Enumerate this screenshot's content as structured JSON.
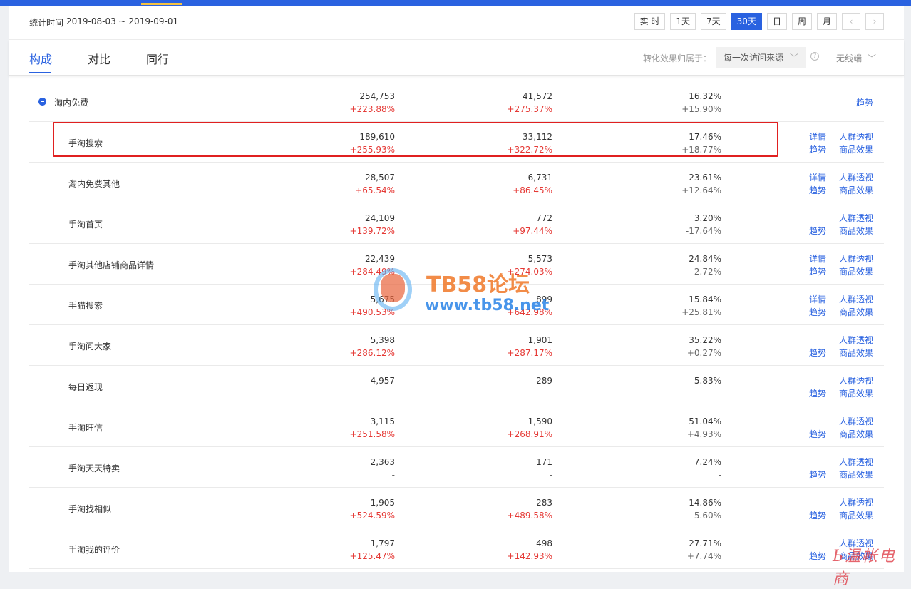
{
  "header": {
    "date_label": "统计时间",
    "date_range": "2019-08-03 ~ 2019-09-01",
    "ranges": [
      "实 时",
      "1天",
      "7天",
      "30天",
      "日",
      "周",
      "月"
    ],
    "active_range": "30天",
    "prev": "‹",
    "next": "›"
  },
  "tabs": [
    {
      "label": "构成",
      "active": true
    },
    {
      "label": "对比",
      "active": false
    },
    {
      "label": "同行",
      "active": false
    }
  ],
  "filters": {
    "attr_label": "转化效果归属于：",
    "attr_value": "每一次访问来源",
    "help": "?",
    "device": "无线端",
    "chevron": "﹀"
  },
  "rows": [
    {
      "name": "淘内免费",
      "parent": true,
      "v1": "254,753",
      "c1": "+223.88%",
      "v2": "41,572",
      "c2": "+275.37%",
      "v3": "16.32%",
      "c3": "+15.90%",
      "links": {
        "trend_only": "趋势"
      }
    },
    {
      "name": "手淘搜索",
      "v1": "189,610",
      "c1": "+255.93%",
      "v2": "33,112",
      "c2": "+322.72%",
      "v3": "17.46%",
      "c3": "+18.77%",
      "links": {
        "detail": "详情",
        "crowd": "人群透视",
        "trend": "趋势",
        "goods": "商品效果"
      }
    },
    {
      "name": "淘内免费其他",
      "v1": "28,507",
      "c1": "+65.54%",
      "v2": "6,731",
      "c2": "+86.45%",
      "v3": "23.61%",
      "c3": "+12.64%",
      "links": {
        "detail": "详情",
        "crowd": "人群透视",
        "trend": "趋势",
        "goods": "商品效果"
      }
    },
    {
      "name": "手淘首页",
      "v1": "24,109",
      "c1": "+139.72%",
      "v2": "772",
      "c2": "+97.44%",
      "v3": "3.20%",
      "c3": "-17.64%",
      "links": {
        "crowd": "人群透视",
        "trend": "趋势",
        "goods": "商品效果"
      }
    },
    {
      "name": "手淘其他店铺商品详情",
      "v1": "22,439",
      "c1": "+284.49%",
      "v2": "5,573",
      "c2": "+274.03%",
      "v3": "24.84%",
      "c3": "-2.72%",
      "links": {
        "detail": "详情",
        "crowd": "人群透视",
        "trend": "趋势",
        "goods": "商品效果"
      }
    },
    {
      "name": "手猫搜索",
      "v1": "5,675",
      "c1": "+490.53%",
      "v2": "899",
      "c2": "+642.98%",
      "v3": "15.84%",
      "c3": "+25.81%",
      "links": {
        "detail": "详情",
        "crowd": "人群透视",
        "trend": "趋势",
        "goods": "商品效果"
      }
    },
    {
      "name": "手淘问大家",
      "v1": "5,398",
      "c1": "+286.12%",
      "v2": "1,901",
      "c2": "+287.17%",
      "v3": "35.22%",
      "c3": "+0.27%",
      "links": {
        "crowd": "人群透视",
        "trend": "趋势",
        "goods": "商品效果"
      }
    },
    {
      "name": "每日返现",
      "v1": "4,957",
      "c1": "-",
      "v2": "289",
      "c2": "-",
      "v3": "5.83%",
      "c3": "-",
      "links": {
        "crowd": "人群透视",
        "trend": "趋势",
        "goods": "商品效果"
      }
    },
    {
      "name": "手淘旺信",
      "v1": "3,115",
      "c1": "+251.58%",
      "v2": "1,590",
      "c2": "+268.91%",
      "v3": "51.04%",
      "c3": "+4.93%",
      "links": {
        "crowd": "人群透视",
        "trend": "趋势",
        "goods": "商品效果"
      }
    },
    {
      "name": "手淘天天特卖",
      "v1": "2,363",
      "c1": "-",
      "v2": "171",
      "c2": "-",
      "v3": "7.24%",
      "c3": "-",
      "links": {
        "crowd": "人群透视",
        "trend": "趋势",
        "goods": "商品效果"
      }
    },
    {
      "name": "手淘找相似",
      "v1": "1,905",
      "c1": "+524.59%",
      "v2": "283",
      "c2": "+489.58%",
      "v3": "14.86%",
      "c3": "-5.60%",
      "links": {
        "crowd": "人群透视",
        "trend": "趋势",
        "goods": "商品效果"
      }
    },
    {
      "name": "手淘我的评价",
      "v1": "1,797",
      "c1": "+125.47%",
      "v2": "498",
      "c2": "+142.93%",
      "v3": "27.71%",
      "c3": "+7.74%",
      "links": {
        "crowd": "人群透视",
        "trend": "趋势",
        "goods": "商品效果"
      }
    }
  ],
  "watermark": {
    "title": "TB58论坛",
    "url": "www.tb58.net",
    "corner": "Ь温帐电商"
  },
  "colors": {
    "accent": "#2a62e0",
    "positive": "#e53935",
    "highlight_box": "#e02020"
  }
}
